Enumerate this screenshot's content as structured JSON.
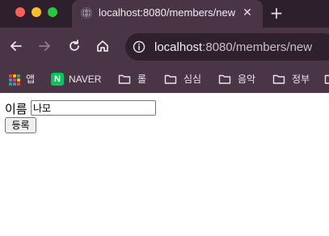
{
  "browser": {
    "tab": {
      "title": "localhost:8080/members/new"
    },
    "close_tab_glyph": "✕",
    "new_tab_glyph": "+",
    "url": {
      "host": "localhost",
      "path": ":8080/members/new"
    },
    "nav_icons": [
      "back-arrow-icon",
      "forward-arrow-icon",
      "reload-icon",
      "home-icon"
    ],
    "bookmarks": [
      {
        "icon": "apps-grid-icon",
        "label": "앱"
      },
      {
        "icon": "naver-icon",
        "label": "NAVER",
        "icon_text": "N"
      },
      {
        "icon": "folder-icon",
        "label": "롤"
      },
      {
        "icon": "folder-icon",
        "label": "심심"
      },
      {
        "icon": "folder-icon",
        "label": "음악"
      },
      {
        "icon": "folder-icon",
        "label": "정부"
      }
    ],
    "colors": {
      "tabbar": "#2d1f2b",
      "toolbar": "#4a3546",
      "omnibox": "#2e202c",
      "traffic_red": "#fe5f57",
      "traffic_yellow": "#febc2e",
      "traffic_green": "#28c840",
      "naver_green": "#03c75a"
    }
  },
  "form": {
    "name_label": "이름",
    "name_value": "나모",
    "submit_label": "등록"
  }
}
